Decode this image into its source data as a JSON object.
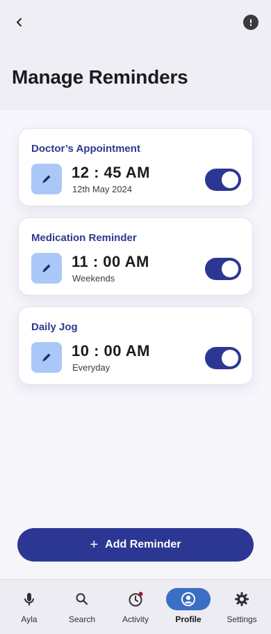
{
  "header": {
    "title": "Manage Reminders"
  },
  "reminders": [
    {
      "title": "Doctor’s Appointment",
      "time": "12 : 45 AM",
      "detail": "12th May 2024",
      "enabled": true
    },
    {
      "title": "Medication Reminder",
      "time": "11 : 00 AM",
      "detail": "Weekends",
      "enabled": true
    },
    {
      "title": "Daily Jog",
      "time": "10 : 00 AM",
      "detail": "Everyday",
      "enabled": true
    }
  ],
  "add_button": {
    "label": "Add Reminder"
  },
  "nav": {
    "items": [
      {
        "label": "Ayla",
        "icon": "mic-icon"
      },
      {
        "label": "Search",
        "icon": "search-icon"
      },
      {
        "label": "Activity",
        "icon": "clock-icon"
      },
      {
        "label": "Profile",
        "icon": "profile-icon",
        "active": true
      },
      {
        "label": "Settings",
        "icon": "gear-icon"
      }
    ]
  },
  "colors": {
    "primary": "#2c3794",
    "title_blue": "#2e3a8c",
    "edit_bg": "#a9c8f7",
    "nav_active": "#3a6fc4",
    "notification": "#b0152c"
  }
}
